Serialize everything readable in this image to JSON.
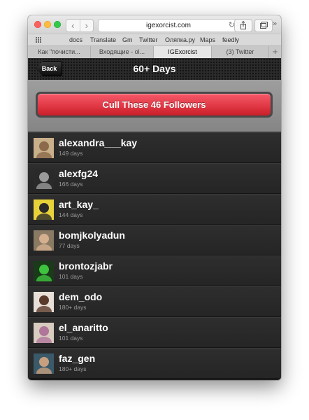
{
  "browser": {
    "url": "igexorcist.com",
    "back_symbol": "‹",
    "forward_symbol": "›",
    "reload_symbol": "↻",
    "more_symbol": "»",
    "bookmarks": [
      "docs",
      "Translate",
      "Gm",
      "Twitter",
      "Оляпка.ру",
      "Maps",
      "feedly"
    ],
    "tabs": [
      {
        "label": "Как \"почисти...",
        "active": false
      },
      {
        "label": "Входящие - ol...",
        "active": false
      },
      {
        "label": "IGExorcist",
        "active": true
      },
      {
        "label": "(3) Twitter",
        "active": false
      }
    ],
    "new_tab_symbol": "+"
  },
  "header": {
    "back_label": "Back",
    "title": "60+ Days"
  },
  "cull_button": {
    "label": "Cull These 46 Followers",
    "color": "#e33c48"
  },
  "followers": [
    {
      "username": "alexandra___kay",
      "days": "149 days",
      "avatar": {
        "bg": "#c9b08a",
        "fg": "#8a6a4a"
      }
    },
    {
      "username": "alexfg24",
      "days": "166 days",
      "avatar": {
        "bg": "#2a2a2a",
        "fg": "#9a9a9a"
      }
    },
    {
      "username": "art_kay_",
      "days": "144 days",
      "avatar": {
        "bg": "#e8d23a",
        "fg": "#2a2a2a"
      }
    },
    {
      "username": "bomjkolyadun",
      "days": "77 days",
      "avatar": {
        "bg": "#8a7a64",
        "fg": "#d4b08e"
      }
    },
    {
      "username": "brontozjabr",
      "days": "101 days",
      "avatar": {
        "bg": "#1a3a1a",
        "fg": "#3ec43e"
      }
    },
    {
      "username": "dem_odo",
      "days": "180+ days",
      "avatar": {
        "bg": "#e8e0d8",
        "fg": "#5a3a2a"
      }
    },
    {
      "username": "el_anaritto",
      "days": "101 days",
      "avatar": {
        "bg": "#d8cbbf",
        "fg": "#b0769a"
      }
    },
    {
      "username": "faz_gen",
      "days": "180+ days",
      "avatar": {
        "bg": "#3a5a6a",
        "fg": "#c8a080"
      }
    }
  ]
}
